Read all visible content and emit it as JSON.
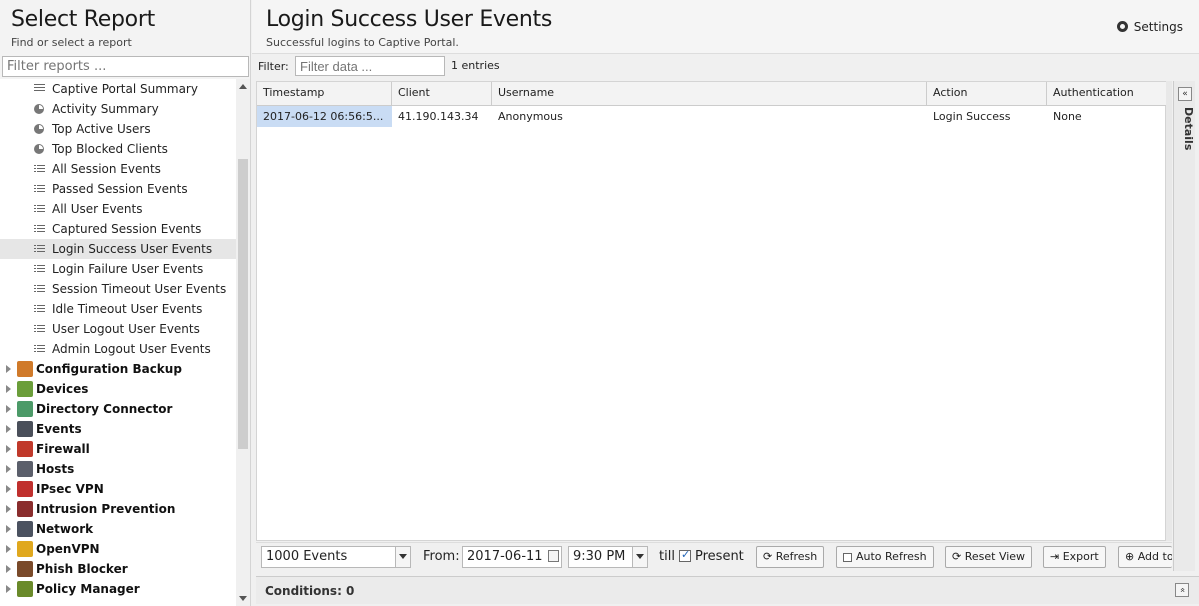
{
  "sidebar": {
    "title": "Select Report",
    "subtitle": "Find or select a report",
    "filter_placeholder": "Filter reports ...",
    "child_items": [
      {
        "label": "Captive Portal Summary",
        "icon": "lines-icon"
      },
      {
        "label": "Activity Summary",
        "icon": "pie-chart-icon"
      },
      {
        "label": "Top Active Users",
        "icon": "pie-chart-icon"
      },
      {
        "label": "Top Blocked Clients",
        "icon": "pie-chart-icon"
      },
      {
        "label": "All Session Events",
        "icon": "list-icon"
      },
      {
        "label": "Passed Session Events",
        "icon": "list-icon"
      },
      {
        "label": "All User Events",
        "icon": "list-icon"
      },
      {
        "label": "Captured Session Events",
        "icon": "list-icon"
      },
      {
        "label": "Login Success User Events",
        "icon": "list-icon",
        "selected": true
      },
      {
        "label": "Login Failure User Events",
        "icon": "list-icon"
      },
      {
        "label": "Session Timeout User Events",
        "icon": "list-icon"
      },
      {
        "label": "Idle Timeout User Events",
        "icon": "list-icon"
      },
      {
        "label": "User Logout User Events",
        "icon": "list-icon"
      },
      {
        "label": "Admin Logout User Events",
        "icon": "list-icon"
      }
    ],
    "groups": [
      {
        "label": "Configuration Backup",
        "color": "#d07a2a"
      },
      {
        "label": "Devices",
        "color": "#6b9e3a"
      },
      {
        "label": "Directory Connector",
        "color": "#4c9a68"
      },
      {
        "label": "Events",
        "color": "#4a4f5a"
      },
      {
        "label": "Firewall",
        "color": "#c0392b"
      },
      {
        "label": "Hosts",
        "color": "#5b5f6b"
      },
      {
        "label": "IPsec VPN",
        "color": "#c0302e"
      },
      {
        "label": "Intrusion Prevention",
        "color": "#8a2d2d"
      },
      {
        "label": "Network",
        "color": "#4b5260"
      },
      {
        "label": "OpenVPN",
        "color": "#e0a81e"
      },
      {
        "label": "Phish Blocker",
        "color": "#7a4a2a"
      },
      {
        "label": "Policy Manager",
        "color": "#6a8a2a"
      }
    ]
  },
  "main": {
    "title": "Login Success User Events",
    "subtitle": "Successful logins to Captive Portal.",
    "settings_label": "Settings",
    "filter_label": "Filter:",
    "filter_placeholder": "Filter data ...",
    "entries_count": "1 entries",
    "columns": [
      "Timestamp",
      "Client",
      "Username",
      "Action",
      "Authentication"
    ],
    "rows": [
      [
        "2017-06-12 06:56:5...",
        "41.190.143.34",
        "Anonymous",
        "Login Success",
        "None"
      ]
    ],
    "details_label": "Details",
    "details_toggle": "«",
    "toolbar": {
      "events_select": "1000 Events",
      "from_label": "From:",
      "from_date": "2017-06-11",
      "from_time": "9:30 PM",
      "till_label": "till",
      "present_label": "Present",
      "present_checked": true,
      "refresh_label": "Refresh",
      "auto_refresh_label": "Auto Refresh",
      "reset_view_label": "Reset View",
      "export_label": "Export",
      "add_to_dashboard_label": "Add to Da"
    },
    "conditions_label": "Conditions: 0",
    "conditions_toggle": "«"
  }
}
